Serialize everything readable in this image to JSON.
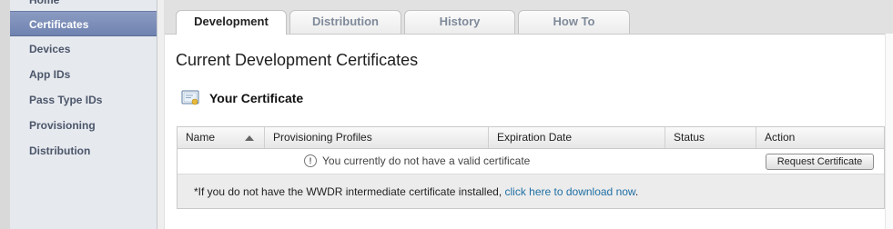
{
  "sidebar": {
    "items": [
      {
        "label": "Home"
      },
      {
        "label": "Certificates",
        "active": true
      },
      {
        "label": "Devices"
      },
      {
        "label": "App IDs"
      },
      {
        "label": "Pass Type IDs"
      },
      {
        "label": "Provisioning"
      },
      {
        "label": "Distribution"
      }
    ]
  },
  "tabs": [
    {
      "label": "Development",
      "active": true
    },
    {
      "label": "Distribution"
    },
    {
      "label": "History"
    },
    {
      "label": "How To"
    }
  ],
  "main": {
    "title": "Current Development Certificates",
    "section_title": "Your Certificate",
    "table": {
      "columns": [
        "Name",
        "Provisioning Profiles",
        "Expiration Date",
        "Status",
        "Action"
      ],
      "notice": "You currently do not have a valid certificate",
      "button_label": "Request Certificate"
    },
    "footer": {
      "text_prefix": "*If you do not have the WWDR intermediate certificate installed, ",
      "link_text": "click here to download now",
      "text_suffix": "."
    }
  },
  "colors": {
    "active_sidebar": "#7a8bb7",
    "link": "#1f6fa3"
  },
  "icons": {
    "certificate": "certificate-icon",
    "sort": "sort-ascending-icon",
    "notice": "exclamation-circle-icon"
  }
}
